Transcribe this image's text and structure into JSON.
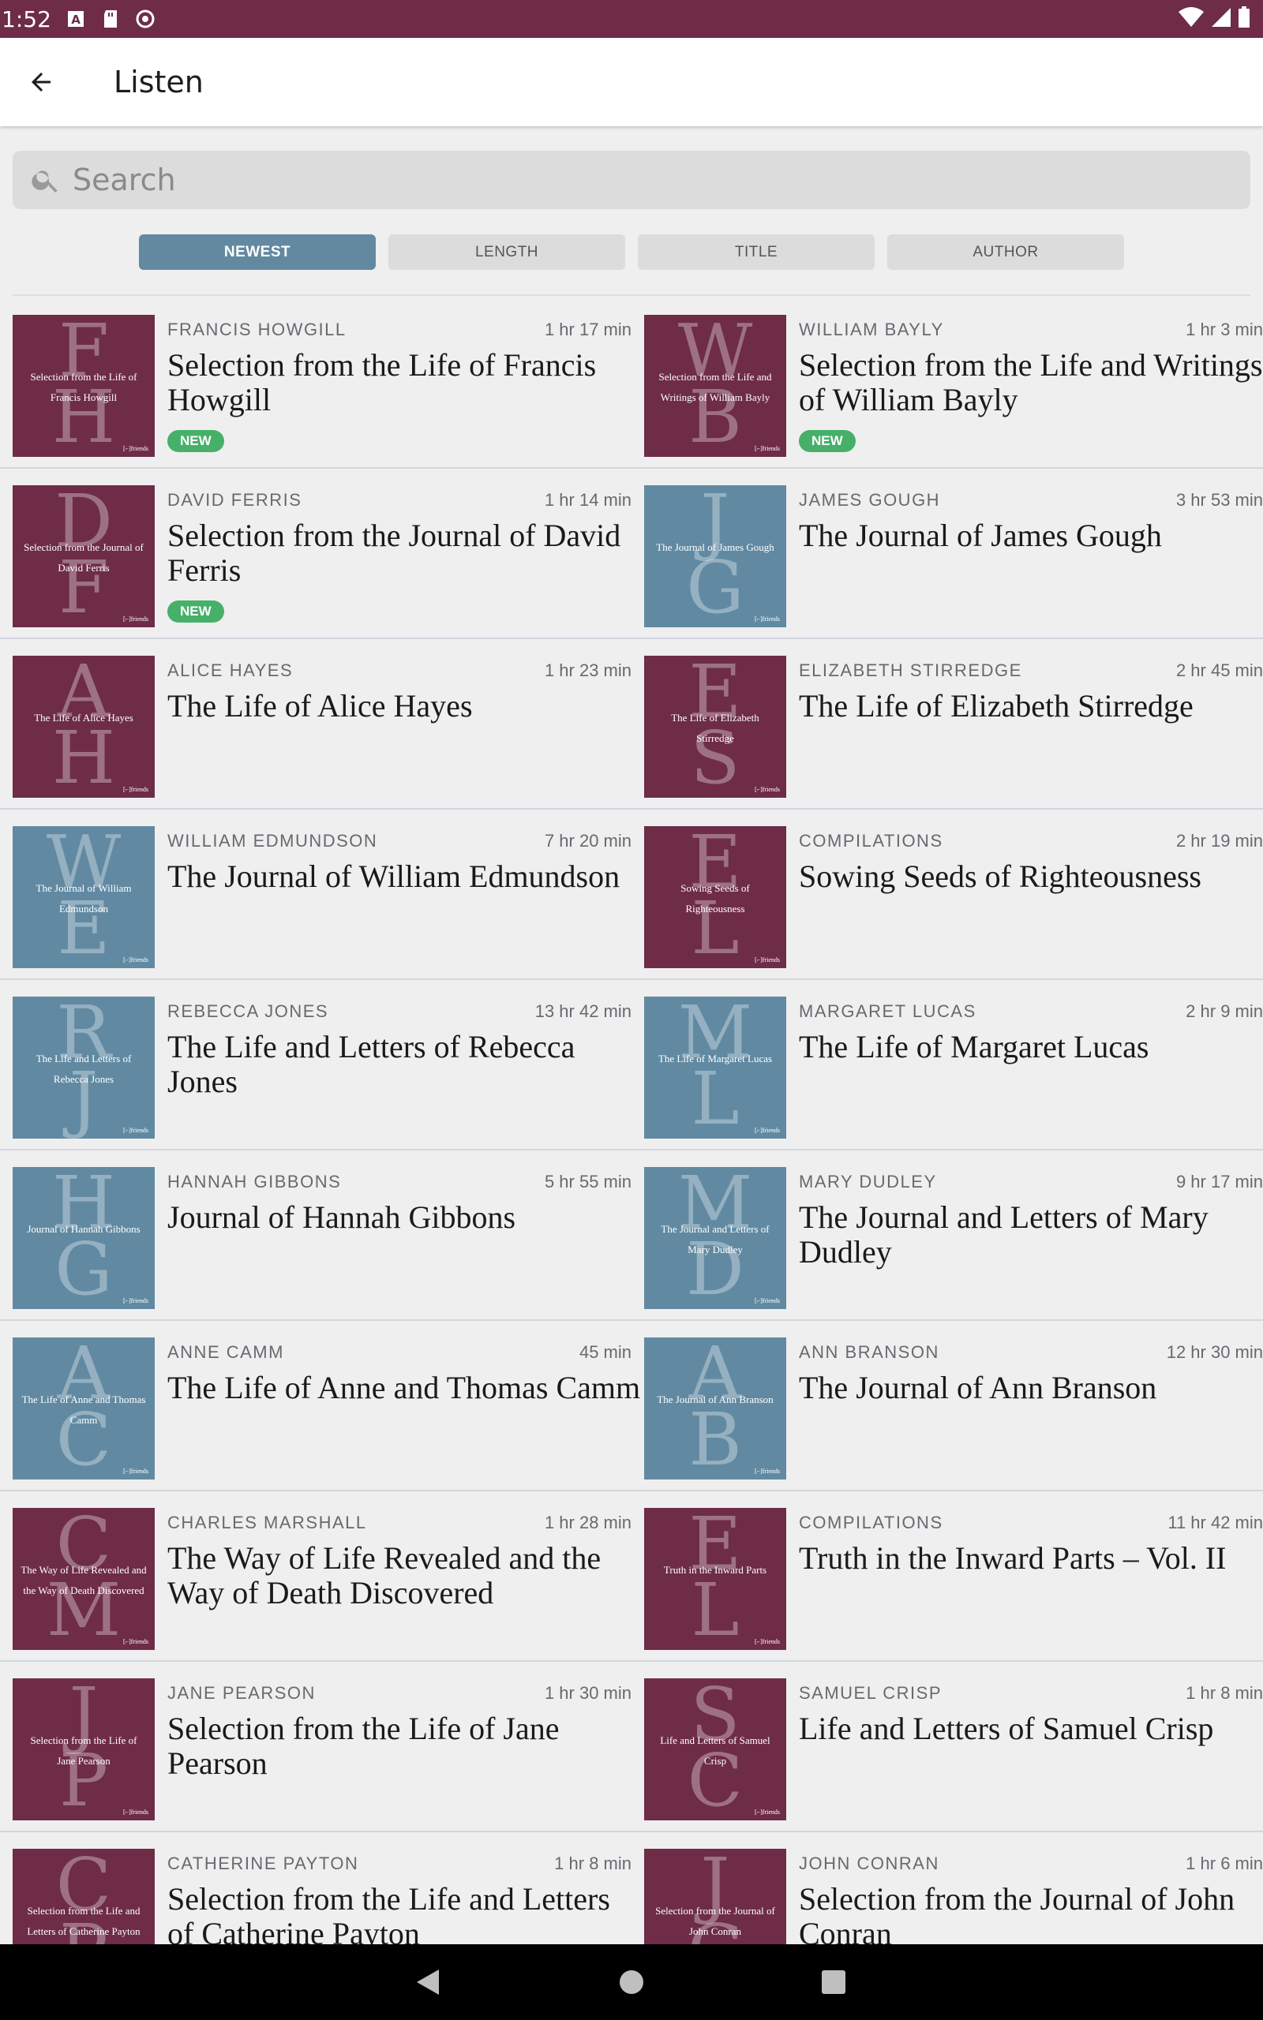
{
  "status_bar": {
    "time": "1:52"
  },
  "app_bar": {
    "title": "Listen"
  },
  "search": {
    "placeholder": "Search"
  },
  "sort_tabs": [
    {
      "label": "NEWEST",
      "active": true
    },
    {
      "label": "LENGTH",
      "active": false
    },
    {
      "label": "TITLE",
      "active": false
    },
    {
      "label": "AUTHOR",
      "active": false
    }
  ],
  "colors": {
    "maroon": "#6e2c47",
    "blue": "#618aa2",
    "new_badge": "#46b068",
    "active_tab": "#6389a1"
  },
  "items": [
    {
      "author": "FRANCIS HOWGILL",
      "duration": "1 hr 17 min",
      "title": "Selection from the Life of Francis Howgill",
      "badge": "NEW",
      "cover": {
        "color": "maroon",
        "letters": [
          "F",
          "H"
        ],
        "text": "Selection from the Life of Francis Howgill"
      }
    },
    {
      "author": "WILLIAM BAYLY",
      "duration": "1 hr 3 min",
      "title": "Selection from the Life and Writings of William Bayly",
      "badge": "NEW",
      "cover": {
        "color": "maroon",
        "letters": [
          "W",
          "B"
        ],
        "text": "Selection from the Life and Writings of William Bayly"
      }
    },
    {
      "author": "DAVID FERRIS",
      "duration": "1 hr 14 min",
      "title": "Selection from the Journal of David Ferris",
      "badge": "NEW",
      "cover": {
        "color": "maroon",
        "letters": [
          "D",
          "F"
        ],
        "text": "Selection from the Journal of David Ferris"
      }
    },
    {
      "author": "JAMES GOUGH",
      "duration": "3 hr 53 min",
      "title": "The Journal of James Gough",
      "badge": "",
      "cover": {
        "color": "blue",
        "letters": [
          "J",
          "G"
        ],
        "text": "The Journal of James Gough"
      }
    },
    {
      "author": "ALICE HAYES",
      "duration": "1 hr 23 min",
      "title": "The Life of Alice Hayes",
      "badge": "",
      "cover": {
        "color": "maroon",
        "letters": [
          "A",
          "H"
        ],
        "text": "The Life of Alice Hayes"
      }
    },
    {
      "author": "ELIZABETH STIRREDGE",
      "duration": "2 hr 45 min",
      "title": "The Life of Elizabeth Stirredge",
      "badge": "",
      "cover": {
        "color": "maroon",
        "letters": [
          "E",
          "S"
        ],
        "text": "The Life of Elizabeth Stirredge"
      }
    },
    {
      "author": "WILLIAM EDMUNDSON",
      "duration": "7 hr 20 min",
      "title": "The Journal of William Edmundson",
      "badge": "",
      "cover": {
        "color": "blue",
        "letters": [
          "W",
          "E"
        ],
        "text": "The Journal of William Edmundson"
      }
    },
    {
      "author": "COMPILATIONS",
      "duration": "2 hr 19 min",
      "title": "Sowing Seeds of Righteousness",
      "badge": "",
      "cover": {
        "color": "maroon",
        "letters": [
          "E",
          "L"
        ],
        "text": "Sowing Seeds of Righteousness"
      }
    },
    {
      "author": "REBECCA JONES",
      "duration": "13 hr 42 min",
      "title": "The Life and Letters of Rebecca Jones",
      "badge": "",
      "cover": {
        "color": "blue",
        "letters": [
          "R",
          "J"
        ],
        "text": "The Life and Letters of Rebecca Jones"
      }
    },
    {
      "author": "MARGARET LUCAS",
      "duration": "2 hr 9 min",
      "title": "The Life of Margaret Lucas",
      "badge": "",
      "cover": {
        "color": "blue",
        "letters": [
          "M",
          "L"
        ],
        "text": "The Life of Margaret Lucas"
      }
    },
    {
      "author": "HANNAH GIBBONS",
      "duration": "5 hr 55 min",
      "title": "Journal of Hannah Gibbons",
      "badge": "",
      "cover": {
        "color": "blue",
        "letters": [
          "H",
          "G"
        ],
        "text": "Journal of Hannah Gibbons"
      }
    },
    {
      "author": "MARY DUDLEY",
      "duration": "9 hr 17 min",
      "title": "The Journal and Letters of Mary Dudley",
      "badge": "",
      "cover": {
        "color": "blue",
        "letters": [
          "M",
          "D"
        ],
        "text": "The Journal and Letters of Mary Dudley"
      }
    },
    {
      "author": "ANNE CAMM",
      "duration": "45 min",
      "title": "The Life of Anne and Thomas Camm",
      "badge": "",
      "cover": {
        "color": "blue",
        "letters": [
          "A",
          "C"
        ],
        "text": "The Life of Anne and Thomas Camm"
      }
    },
    {
      "author": "ANN BRANSON",
      "duration": "12 hr 30 min",
      "title": "The Journal of Ann Branson",
      "badge": "",
      "cover": {
        "color": "blue",
        "letters": [
          "A",
          "B"
        ],
        "text": "The Journal of Ann Branson"
      }
    },
    {
      "author": "CHARLES MARSHALL",
      "duration": "1 hr 28 min",
      "title": "The Way of Life Revealed and the Way of Death Discovered",
      "badge": "",
      "cover": {
        "color": "maroon",
        "letters": [
          "C",
          "M"
        ],
        "text": "The Way of Life Revealed and the Way of Death Discovered"
      }
    },
    {
      "author": "COMPILATIONS",
      "duration": "11 hr 42 min",
      "title": "Truth in the Inward Parts – Vol. II",
      "badge": "",
      "cover": {
        "color": "maroon",
        "letters": [
          "E",
          "L"
        ],
        "text": "Truth in the Inward Parts"
      }
    },
    {
      "author": "JANE PEARSON",
      "duration": "1 hr 30 min",
      "title": "Selection from the Life of Jane Pearson",
      "badge": "",
      "cover": {
        "color": "maroon",
        "letters": [
          "J",
          "P"
        ],
        "text": "Selection from the Life of Jane Pearson"
      }
    },
    {
      "author": "SAMUEL CRISP",
      "duration": "1 hr 8 min",
      "title": "Life and Letters of Samuel Crisp",
      "badge": "",
      "cover": {
        "color": "maroon",
        "letters": [
          "S",
          "C"
        ],
        "text": "Life and Letters of Samuel Crisp"
      }
    },
    {
      "author": "CATHERINE PAYTON",
      "duration": "1 hr 8 min",
      "title": "Selection from the Life and Letters of Catherine Payton",
      "badge": "",
      "cover": {
        "color": "maroon",
        "letters": [
          "C",
          "P"
        ],
        "text": "Selection from the Life and Letters of Catherine Payton"
      }
    },
    {
      "author": "JOHN CONRAN",
      "duration": "1 hr 6 min",
      "title": "Selection from the Journal of John Conran",
      "badge": "",
      "cover": {
        "color": "maroon",
        "letters": [
          "J",
          "C"
        ],
        "text": "Selection from the Journal of John Conran"
      }
    }
  ]
}
